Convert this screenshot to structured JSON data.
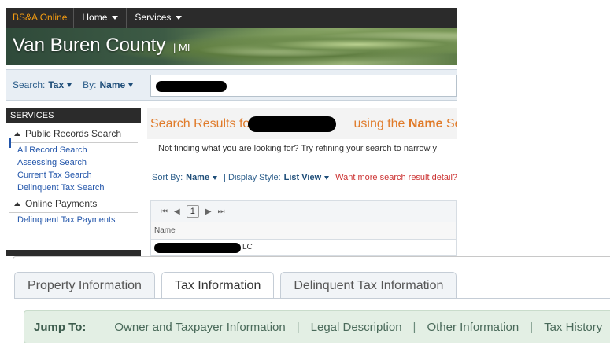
{
  "topnav": {
    "brand": "BS&A Online",
    "items": [
      {
        "label": "Home"
      },
      {
        "label": "Services"
      }
    ]
  },
  "banner": {
    "county": "Van Buren County",
    "state": "| MI"
  },
  "search": {
    "search_label": "Search:",
    "search_value": "Tax",
    "by_label": "By:",
    "by_value": "Name",
    "input_value": "[redacted]"
  },
  "services": {
    "header": "SERVICES",
    "groups": [
      {
        "title": "Public Records Search",
        "links": [
          "All Record Search",
          "Assessing Search",
          "Current Tax Search",
          "Delinquent Tax Search"
        ]
      },
      {
        "title": "Online Payments",
        "links": [
          "Delinquent Tax Payments"
        ]
      }
    ]
  },
  "results": {
    "title_prefix": "Search Results for",
    "title_mid": "using the",
    "title_field": "Name",
    "title_suffix": "Se",
    "hint": "Not finding what you are looking for? Try refining your search to narrow y",
    "sort_label": "Sort By:",
    "sort_value": "Name",
    "display_label": "| Display Style:",
    "display_value": "List View",
    "more_detail": "Want more search result detail?",
    "pager": {
      "first": "⏮",
      "prev": "◀",
      "page": "1",
      "next": "▶",
      "last": "⏭"
    },
    "column_header": "Name",
    "row_suffix": "LC"
  },
  "bottom": {
    "tabs": [
      {
        "label": "Property Information",
        "active": false
      },
      {
        "label": "Tax Information",
        "active": true
      },
      {
        "label": "Delinquent Tax Information",
        "active": false
      }
    ],
    "jump_label": "Jump To:",
    "jump_links": [
      "Owner and Taxpayer Information",
      "Legal Description",
      "Other Information",
      "Tax History"
    ],
    "separator": "|"
  },
  "colors": {
    "nav_bg": "#2b2b2b",
    "brand": "#f39c12",
    "results_title": "#e07b2a",
    "link": "#2255aa",
    "jump_bg": "#e3efe4"
  }
}
